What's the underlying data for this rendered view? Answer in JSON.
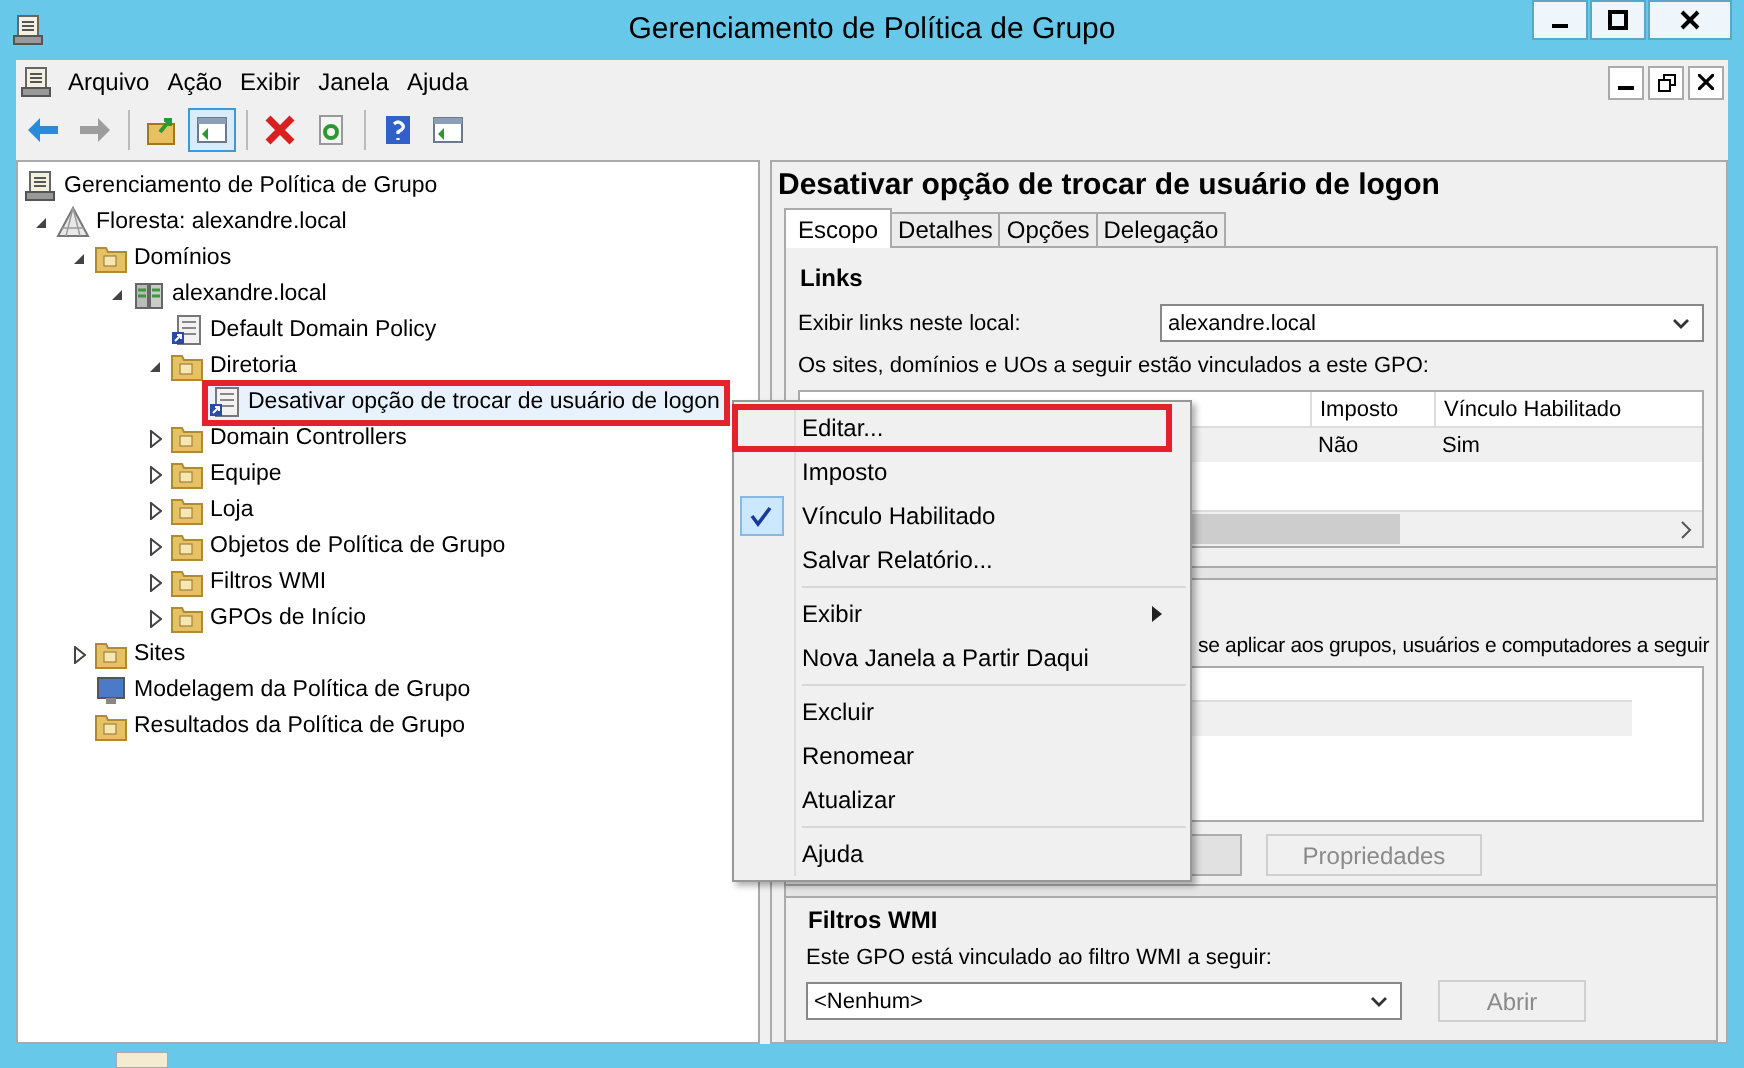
{
  "window": {
    "title": "Gerenciamento de Política de Grupo"
  },
  "menu_bar": [
    "Arquivo",
    "Ação",
    "Exibir",
    "Janela",
    "Ajuda"
  ],
  "toolbar": [
    [
      {
        "kind": "back",
        "disabled": false,
        "pressed": false
      },
      {
        "kind": "forward",
        "disabled": true,
        "pressed": false
      }
    ],
    [
      {
        "kind": "up-folder",
        "disabled": false,
        "pressed": false
      },
      {
        "kind": "tree-toggle",
        "disabled": false,
        "pressed": true
      }
    ],
    [
      {
        "kind": "delete",
        "disabled": false,
        "pressed": false
      },
      {
        "kind": "refresh",
        "disabled": false,
        "pressed": false
      }
    ],
    [
      {
        "kind": "help",
        "disabled": false,
        "pressed": false
      },
      {
        "kind": "action-pane",
        "disabled": false,
        "pressed": false
      }
    ]
  ],
  "tree": [
    {
      "label": "Gerenciamento de Política de Grupo",
      "kind": "console",
      "selected": false,
      "highlighted": false,
      "children": [
        {
          "label": "Floresta: alexandre.local",
          "kind": "forest",
          "expanded": true,
          "selected": false,
          "highlighted": false,
          "children": [
            {
              "label": "Domínios",
              "kind": "domains",
              "expanded": true,
              "selected": false,
              "highlighted": false,
              "children": [
                {
                  "label": "alexandre.local",
                  "kind": "domain",
                  "expanded": true,
                  "selected": false,
                  "highlighted": false,
                  "children": [
                    {
                      "label": "Default Domain Policy",
                      "kind": "gpo",
                      "selected": false,
                      "highlighted": false
                    },
                    {
                      "label": "Diretoria",
                      "kind": "ou",
                      "expanded": true,
                      "selected": false,
                      "highlighted": false,
                      "children": [
                        {
                          "label": "Desativar opção de trocar de usuário de logon",
                          "kind": "gpo",
                          "selected": true,
                          "highlighted": true
                        }
                      ]
                    },
                    {
                      "label": "Domain Controllers",
                      "kind": "ou",
                      "expanded": false,
                      "selected": false,
                      "highlighted": false
                    },
                    {
                      "label": "Equipe",
                      "kind": "ou",
                      "expanded": false,
                      "selected": false,
                      "highlighted": false
                    },
                    {
                      "label": "Loja",
                      "kind": "ou",
                      "expanded": false,
                      "selected": false,
                      "highlighted": false
                    },
                    {
                      "label": "Objetos de Política de Grupo",
                      "kind": "gpo-folder",
                      "expanded": false,
                      "selected": false,
                      "highlighted": false
                    },
                    {
                      "label": "Filtros WMI",
                      "kind": "wmi-folder",
                      "expanded": false,
                      "selected": false,
                      "highlighted": false
                    },
                    {
                      "label": "GPOs de Início",
                      "kind": "starter-folder",
                      "expanded": false,
                      "selected": false,
                      "highlighted": false
                    }
                  ]
                }
              ]
            },
            {
              "label": "Sites",
              "kind": "sites",
              "expanded": false,
              "selected": false,
              "highlighted": false
            },
            {
              "label": "Modelagem da Política de Grupo",
              "kind": "modeling",
              "selected": false,
              "highlighted": false
            },
            {
              "label": "Resultados da Política de Grupo",
              "kind": "results",
              "selected": false,
              "highlighted": false
            }
          ]
        }
      ]
    }
  ],
  "details": {
    "title": "Desativar opção de trocar de usuário de logon",
    "tabs": [
      {
        "label": "Escopo",
        "selected": true
      },
      {
        "label": "Detalhes",
        "selected": false
      },
      {
        "label": "Opções",
        "selected": false
      },
      {
        "label": "Delegação",
        "selected": false
      }
    ],
    "links": {
      "heading": "Links",
      "location_label": "Exibir links neste local:",
      "location_value": "alexandre.local",
      "linked_label": "Os sites, domínios e UOs a seguir estão vinculados a este GPO:",
      "columns": [
        "Imposto",
        "Vínculo Habilitado"
      ],
      "rows": [
        [
          "Não",
          "Sim"
        ]
      ]
    },
    "security": {
      "text": "se aplicar aos grupos, usuários e computadores a seguir",
      "buttons": [
        {
          "label": "Propriedades",
          "disabled": true
        }
      ]
    },
    "wmi": {
      "heading": "Filtros WMI",
      "label": "Este GPO está vinculado ao filtro WMI a seguir:",
      "value": "<Nenhum>",
      "button": {
        "label": "Abrir",
        "disabled": true
      }
    }
  },
  "context_menu": [
    [
      {
        "label": "Editar...",
        "checked": false,
        "submenu": false,
        "highlighted": true
      },
      {
        "label": "Imposto",
        "checked": false,
        "submenu": false,
        "highlighted": false
      },
      {
        "label": "Vínculo Habilitado",
        "checked": true,
        "submenu": false,
        "highlighted": false
      },
      {
        "label": "Salvar Relatório...",
        "checked": false,
        "submenu": false,
        "highlighted": false
      }
    ],
    [
      {
        "label": "Exibir",
        "checked": false,
        "submenu": true,
        "highlighted": false
      },
      {
        "label": "Nova Janela a Partir Daqui",
        "checked": false,
        "submenu": false,
        "highlighted": false
      }
    ],
    [
      {
        "label": "Excluir",
        "checked": false,
        "submenu": false,
        "highlighted": false
      },
      {
        "label": "Renomear",
        "checked": false,
        "submenu": false,
        "highlighted": false
      },
      {
        "label": "Atualizar",
        "checked": false,
        "submenu": false,
        "highlighted": false
      }
    ],
    [
      {
        "label": "Ajuda",
        "checked": false,
        "submenu": false,
        "highlighted": false
      }
    ]
  ]
}
